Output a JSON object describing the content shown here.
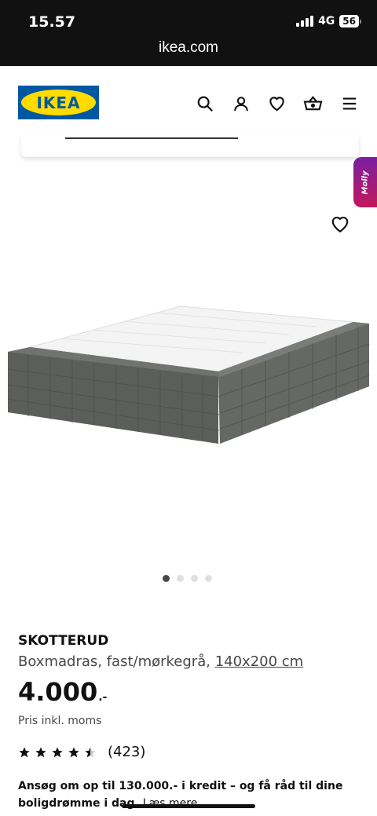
{
  "status_bar": {
    "time": "15.57",
    "network": "4G",
    "battery": "56"
  },
  "browser": {
    "url": "ikea.com"
  },
  "header": {
    "logo_text": "IKEA",
    "icons": [
      "search-icon",
      "account-icon",
      "favourites-icon",
      "basket-icon",
      "menu-icon"
    ]
  },
  "chat": {
    "label": "Molly"
  },
  "gallery": {
    "image_count": 4,
    "active_index": 0
  },
  "product": {
    "name": "SKOTTERUD",
    "description": "Boxmadras, fast/mørkegrå, ",
    "size": "140x200 cm",
    "price": "4.000",
    "price_suffix": ".-",
    "vat_note": "Pris inkl. moms",
    "rating": 4.5,
    "review_count": "(423)"
  },
  "credit": {
    "text": "Ansøg om op til 130.000.- i kredit – og få råd til dine boligdrømme i dag. ",
    "link": "Læs mere"
  },
  "colors": {
    "ikea_blue": "#0058a3",
    "ikea_yellow": "#ffdb00",
    "chat_purple": "#7a1fa2"
  }
}
